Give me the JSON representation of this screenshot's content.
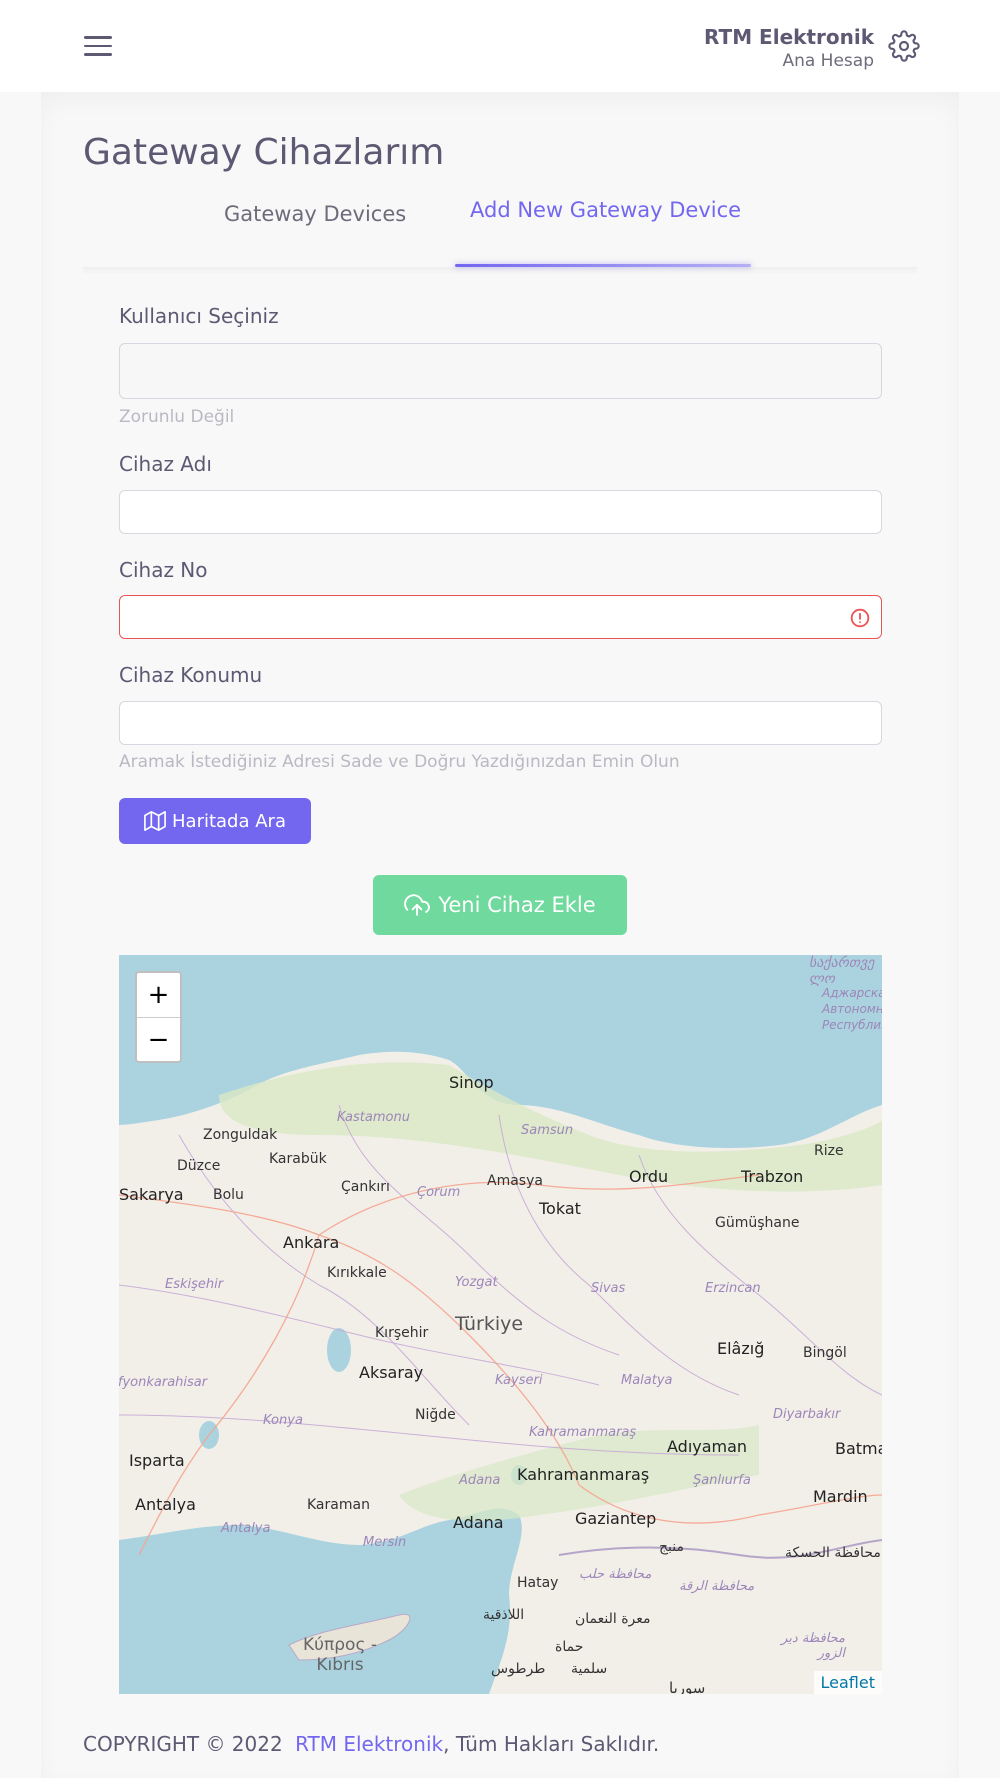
{
  "header": {
    "user_name": "RTM Elektronik",
    "user_role": "Ana Hesap"
  },
  "page": {
    "title": "Gateway Cihazlarım"
  },
  "tabs": [
    {
      "label": "Gateway Devices",
      "active": false
    },
    {
      "label": "Add New Gateway Device",
      "active": true
    }
  ],
  "form": {
    "user_label": "Kullanıcı Seçiniz",
    "user_hint": "Zorunlu Değil",
    "name_label": "Cihaz Adı",
    "name_value": "",
    "no_label": "Cihaz No",
    "no_value": "",
    "location_label": "Cihaz Konumu",
    "location_value": "",
    "location_hint": "Aramak İstediğiniz Adresi Sade ve Doğru Yazdığınızdan Emin Olun",
    "map_search_button": "Haritada Ara",
    "add_button": "Yeni Cihaz Ekle"
  },
  "map": {
    "zoom_in": "+",
    "zoom_out": "−",
    "attribution": "Leaflet",
    "labels": {
      "sinop": "Sinop",
      "zonguldak": "Zonguldak",
      "kastamonu": "Kastamonu",
      "samsun": "Samsun",
      "rize": "Rize",
      "karabuk": "Karabük",
      "duzce": "Düzce",
      "sakarya": "Sakarya",
      "bolu": "Bolu",
      "cankiri": "Çankırı",
      "corum": "Çorum",
      "amasya": "Amasya",
      "ordu": "Ordu",
      "trabzon": "Trabzon",
      "tokat": "Tokat",
      "gumushane": "Gümüşhane",
      "ankara": "Ankara",
      "kirikkale": "Kırıkkale",
      "eskisehir": "Eskişehir",
      "yozgat": "Yozgat",
      "sivas": "Sivas",
      "erzincan": "Erzincan",
      "turkiye": "Türkiye",
      "kirsehir": "Kırşehir",
      "elazig": "Elâzığ",
      "bingol": "Bingöl",
      "afyonkarahisar": "Afyonkarahisar",
      "aksaray": "Aksaray",
      "kayseri": "Kayseri",
      "malatya": "Malatya",
      "konya": "Konya",
      "nigde": "Niğde",
      "diyarbakir": "Diyarbakır",
      "kahramanmaras_prov": "Kahramanmaraş",
      "adiyaman": "Adıyaman",
      "batman": "Batman",
      "isparta": "Isparta",
      "adana_prov": "Adana",
      "kahramanmaras": "Kahramanmaraş",
      "sanliurfa": "Şanlıurfa",
      "antalya": "Antalya",
      "karaman": "Karaman",
      "mardin": "Mardin",
      "antalya_prov": "Antalya",
      "mersin": "Mersin",
      "adana": "Adana",
      "gaziantep": "Gaziantep",
      "manbij": "منبج",
      "hasakah": "محافظة الحسكة",
      "aleppo": "محافظة حلب",
      "raqqa": "محافظة الرقة",
      "hatay": "Hatay",
      "latakia": "اللاذقية",
      "maarat": "معرة النعمان",
      "hama": "حماة",
      "deirezzor": "محافظة دير الزور",
      "cyprus": "Κύπρος - Kıbrıs",
      "tartus": "طرطوس",
      "salamiyah": "سلمية",
      "syria": "سوريا",
      "georgia": "საქართველო",
      "adjara": "Аджарская Автономная Республика"
    }
  },
  "footer": {
    "prefix": "COPYRIGHT © 2022",
    "company": "RTM Elektronik",
    "suffix": ", Tüm Hakları Saklıdır."
  },
  "colors": {
    "primary": "#7367f0",
    "success": "#6fd99e",
    "danger": "#ea5455"
  }
}
